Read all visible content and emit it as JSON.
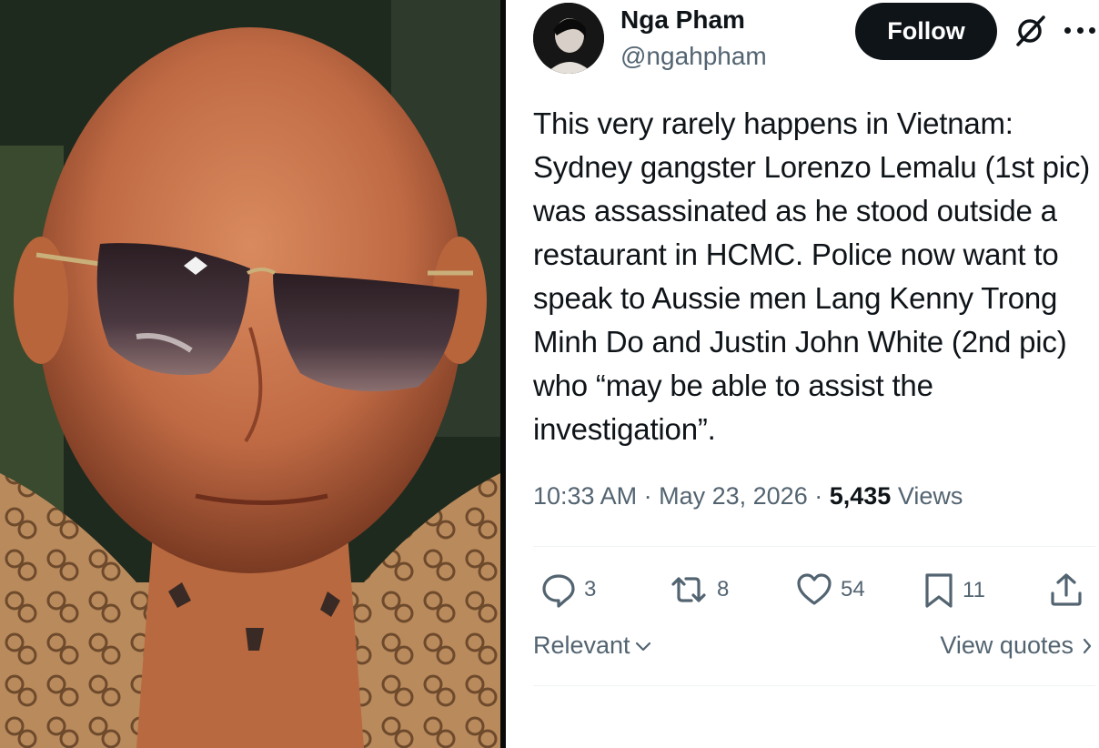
{
  "media": {
    "icon": "photo-of-man-with-sunglasses"
  },
  "author": {
    "display_name": "Nga Pham",
    "handle": "@ngahpham",
    "avatar_icon": "avatar-portrait"
  },
  "header": {
    "follow_label": "Follow",
    "grok_icon": "grok-slash-circle-icon",
    "more_icon": "more-dots-icon"
  },
  "tweet": {
    "text": "This very rarely happens in Vietnam: Sydney gangster Lorenzo Lemalu (1st pic) was assassinated as he stood outside a restaurant in HCMC. Police now want to speak to Aussie men Lang Kenny Trong Minh Do and Justin John White (2nd pic) who “may be able to assist the investigation”.",
    "time": "10:33 AM",
    "date": "May 23, 2026",
    "dot": "·",
    "views_count": "5,435",
    "views_label": "Views"
  },
  "actions": {
    "replies": "3",
    "reposts": "8",
    "likes": "54",
    "bookmarks": "11"
  },
  "filter": {
    "sort_label": "Relevant",
    "view_quotes_label": "View quotes"
  },
  "colors": {
    "text_primary": "#0f1419",
    "text_secondary": "#536471",
    "follow_bg": "#0f1419",
    "divider": "#eff3f4"
  }
}
